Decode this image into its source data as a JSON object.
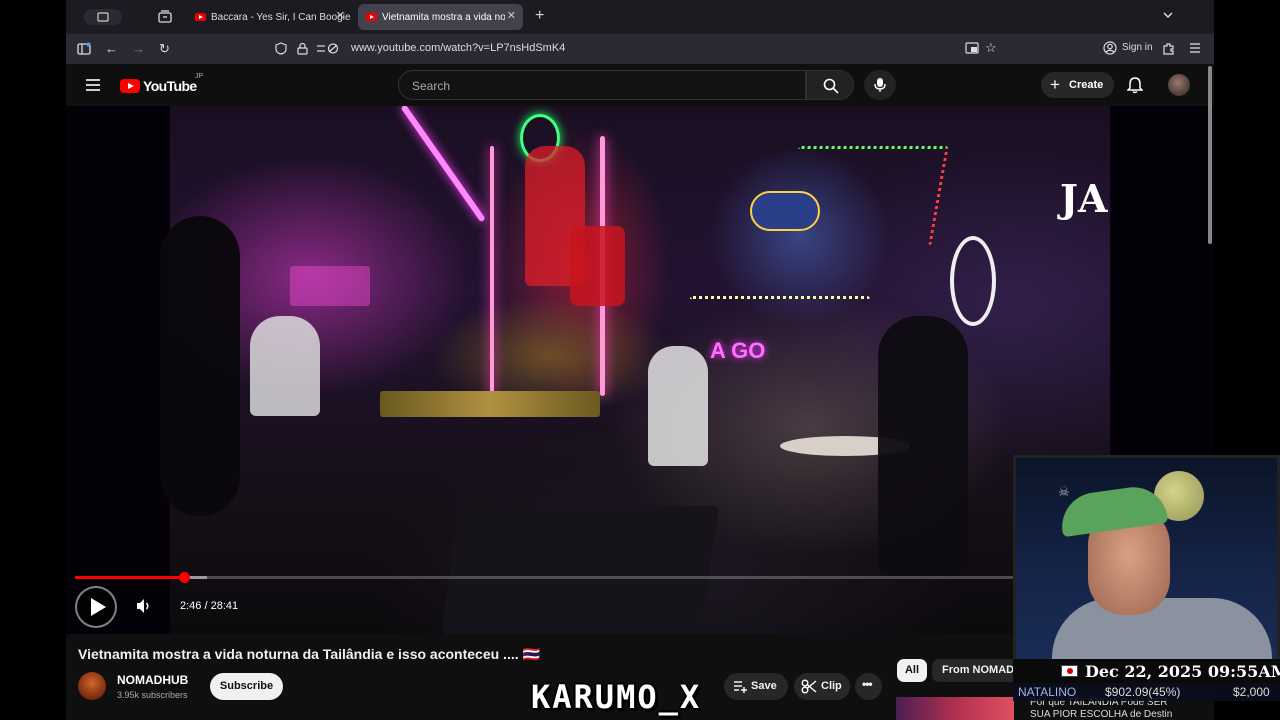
{
  "browser": {
    "tabs": [
      {
        "label": "Baccara - Yes Sir, I Can Boogie",
        "active": false
      },
      {
        "label": "Vietnamita mostra a vida noturna",
        "active": true
      }
    ],
    "url": "www.youtube.com/watch?v=LP7nsHdSmK4",
    "sign_in": "Sign in"
  },
  "youtube": {
    "logo_text": "YouTube",
    "region": "JP",
    "search_placeholder": "Search",
    "create_label": "Create"
  },
  "video": {
    "current_time": "2:46",
    "duration": "28:41",
    "time_display": "2:46 / 28:41",
    "progress": 0.0964,
    "buffered": 0.117,
    "title": "Vietnamita mostra a vida noturna da Tailândia e isso aconteceu .... 🇹🇭"
  },
  "channel": {
    "name": "NOMADHUB",
    "subscribers": "3.95k subscribers",
    "subscribe_label": "Subscribe"
  },
  "actions": {
    "save_label": "Save",
    "clip_label": "Clip"
  },
  "sidebar": {
    "chips": [
      "All",
      "From NOMADHUB"
    ],
    "next_title_line1": "Por que TAILÂNDIA Pode SER",
    "next_title_line2": "SUA PIOR ESCOLHA de Destin"
  },
  "overlay": {
    "datetime": "Dec 22, 2025 09:55AM",
    "name": "NATALINO",
    "amount": "$902.09(45%)",
    "goal": "$2,000",
    "watermark": "KARUMO_X"
  },
  "colors": {
    "progress": "#ff0000",
    "youtube_red": "#ff0000",
    "background": "#0f0f0f"
  }
}
